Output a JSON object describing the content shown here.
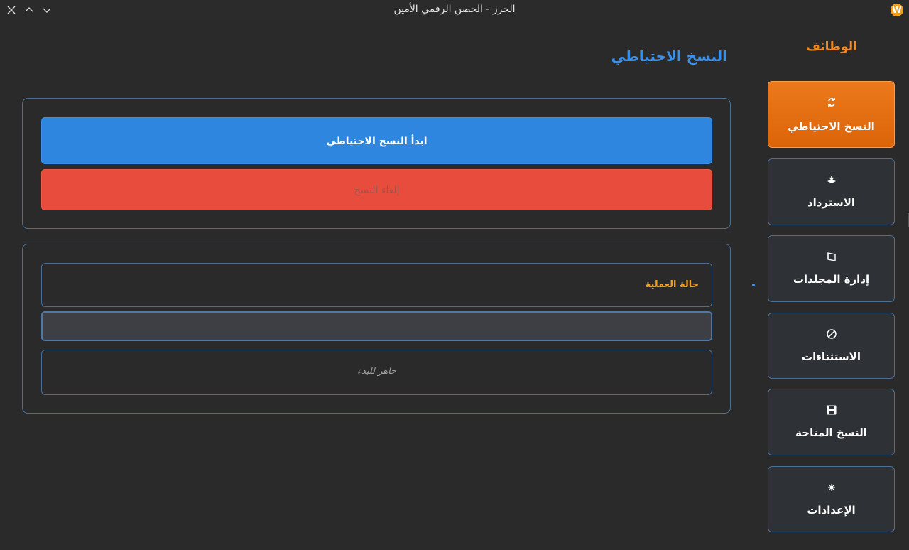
{
  "window": {
    "title": "الجرز - الحصن الرقمي الأمين",
    "logo_letter": "W"
  },
  "sidebar": {
    "title": "الوظائف",
    "items": [
      {
        "label": "النسخ الاحتياطي",
        "icon": "sync-icon",
        "active": true
      },
      {
        "label": "الاسترداد",
        "icon": "restore-icon",
        "active": false
      },
      {
        "label": "إدارة المجلدات",
        "icon": "folder-icon",
        "active": false
      },
      {
        "label": "الاستثناءات",
        "icon": "block-icon",
        "active": false
      },
      {
        "label": "النسخ المتاحة",
        "icon": "save-icon",
        "active": false
      },
      {
        "label": "الإعدادات",
        "icon": "gear-icon",
        "active": false
      }
    ]
  },
  "main": {
    "page_title": "النسخ الاحتياطي",
    "start_button": "ابدأ النسخ الاحتياطي",
    "cancel_button": "إلغاء النسخ",
    "status_label": "حالة العملية",
    "progress": 0,
    "status_message": "جاهز للبدء"
  },
  "colors": {
    "accent_orange": "#e36a10",
    "accent_blue": "#2e86de",
    "danger_red": "#e74c3c",
    "background": "#2a2a2a"
  }
}
